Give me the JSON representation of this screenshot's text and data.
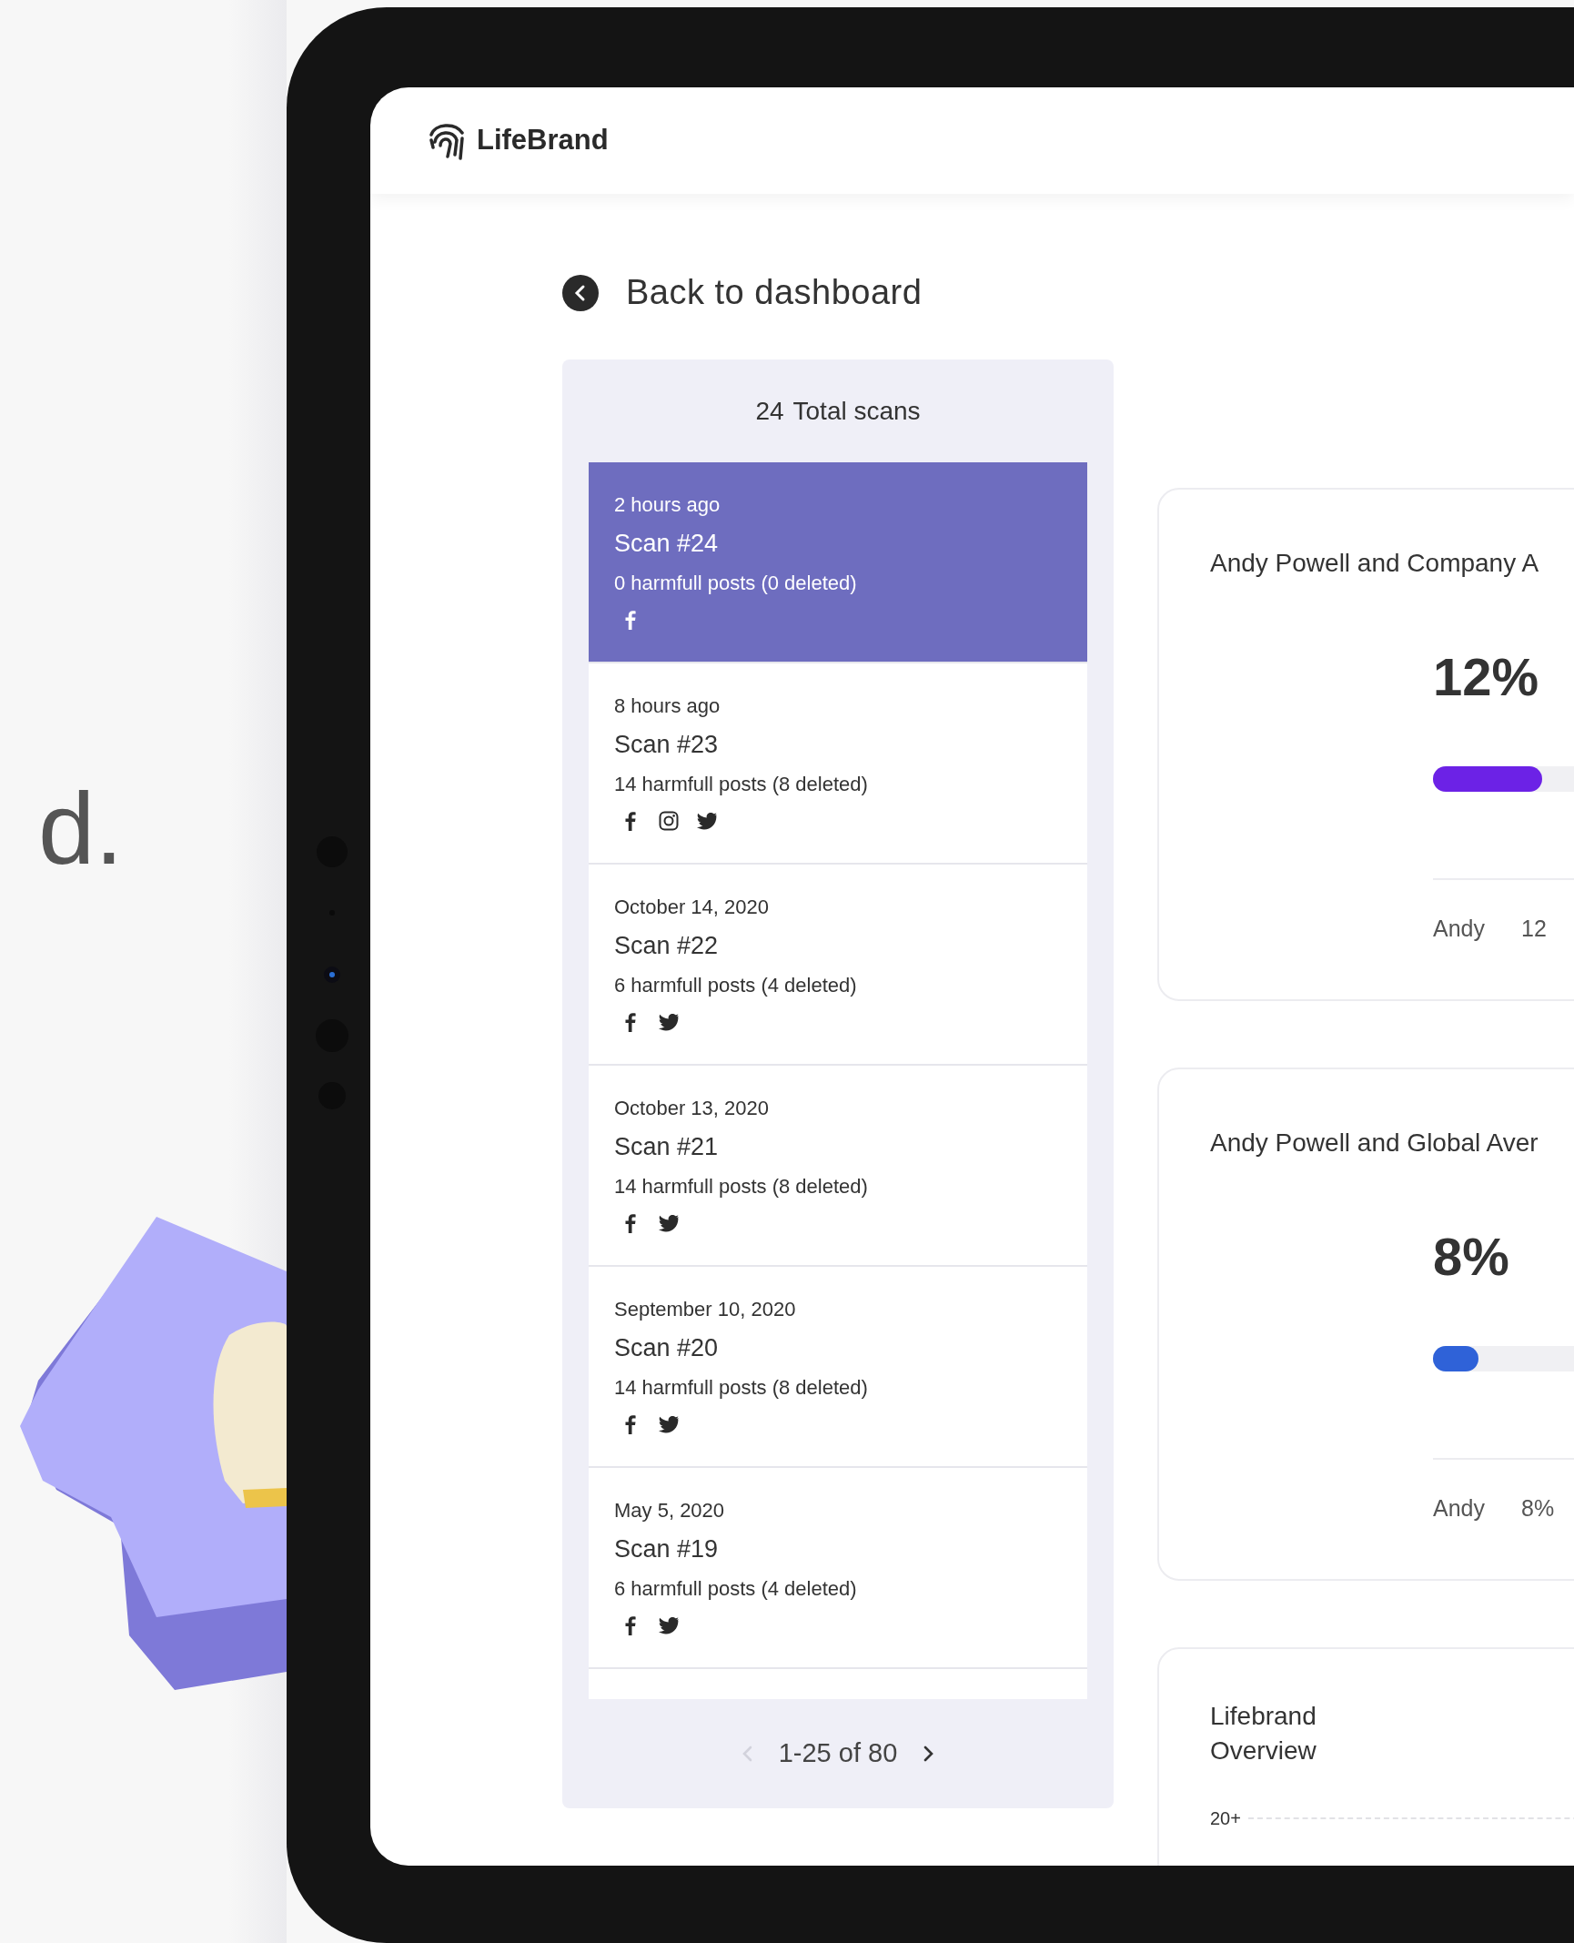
{
  "backdrop": {
    "text": "d."
  },
  "app": {
    "logo": "LifeBrand"
  },
  "back_link": "Back to dashboard",
  "scans": {
    "total_count": "24",
    "total_label": "Total scans",
    "items": [
      {
        "date": "2 hours ago",
        "title": "Scan #24",
        "summary": "0 harmfull posts (0 deleted)",
        "platforms": [
          {
            "kind": "facebook"
          }
        ],
        "selected": true
      },
      {
        "date": "8 hours ago",
        "title": "Scan #23",
        "summary": "14 harmfull posts (8 deleted)",
        "platforms": [
          {
            "kind": "facebook"
          },
          {
            "kind": "instagram"
          },
          {
            "kind": "twitter"
          }
        ],
        "selected": false
      },
      {
        "date": "October 14, 2020",
        "title": "Scan #22",
        "summary": "6 harmfull posts (4 deleted)",
        "platforms": [
          {
            "kind": "facebook"
          },
          {
            "kind": "twitter"
          }
        ],
        "selected": false
      },
      {
        "date": "October 13, 2020",
        "title": "Scan #21",
        "summary": "14 harmfull posts (8 deleted)",
        "platforms": [
          {
            "kind": "facebook"
          },
          {
            "kind": "twitter"
          }
        ],
        "selected": false
      },
      {
        "date": "September 10, 2020",
        "title": "Scan #20",
        "summary": "14 harmfull posts (8 deleted)",
        "platforms": [
          {
            "kind": "facebook"
          },
          {
            "kind": "twitter"
          }
        ],
        "selected": false
      },
      {
        "date": "May 5, 2020",
        "title": "Scan #19",
        "summary": "6 harmfull posts (4 deleted)",
        "platforms": [
          {
            "kind": "facebook"
          },
          {
            "kind": "twitter"
          }
        ],
        "selected": false
      }
    ],
    "pagination": {
      "range": "1-25 of 80",
      "prev": {
        "disabled": true
      },
      "next": {
        "disabled": false
      }
    }
  },
  "cards": [
    {
      "title": "Andy Powell and Company A",
      "value": "12%",
      "level": 0.12,
      "color": "#6c22e6",
      "legend_label": "Andy",
      "legend_value": "12"
    },
    {
      "title": "Andy Powell and Global Aver",
      "value": "8%",
      "level": 0.05,
      "color": "#2f62d8",
      "legend_label": "Andy",
      "legend_value": "8%"
    }
  ],
  "overview": {
    "title": "Lifebrand Overview",
    "tick": "20+"
  }
}
